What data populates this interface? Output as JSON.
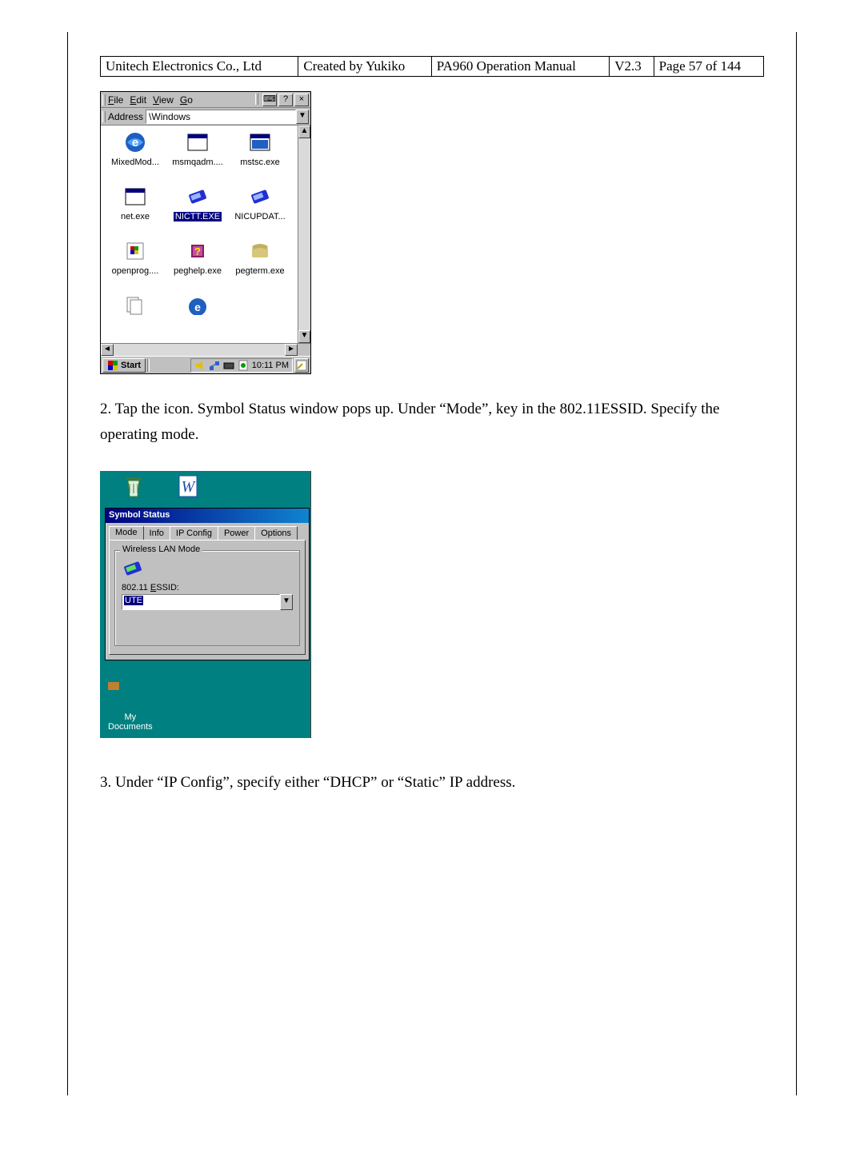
{
  "header": {
    "cells": [
      "Unitech Electronics Co., Ltd",
      "Created by Yukiko",
      "PA960 Operation Manual",
      "V2.3",
      "Page 57 of 144"
    ]
  },
  "screenshot1": {
    "menu": {
      "file": "File",
      "edit": "Edit",
      "view": "View",
      "go": "Go"
    },
    "toolbar": {
      "keyboard_icon": "⌨",
      "help_icon": "?",
      "close_icon": "×"
    },
    "address_label": "Address",
    "address_value": "\\Windows",
    "scroll": {
      "up": "▲",
      "down": "▼",
      "left": "◄",
      "right": "►"
    },
    "files": [
      {
        "name": "MixedMod...",
        "selected": false,
        "icon": "ie"
      },
      {
        "name": "msmqadm....",
        "selected": false,
        "icon": "win"
      },
      {
        "name": "mstsc.exe",
        "selected": false,
        "icon": "winblk"
      },
      {
        "name": "net.exe",
        "selected": false,
        "icon": "win"
      },
      {
        "name": "NICTT.EXE",
        "selected": true,
        "icon": "nic"
      },
      {
        "name": "NICUPDAT...",
        "selected": false,
        "icon": "nic"
      },
      {
        "name": "openprog....",
        "selected": false,
        "icon": "flag"
      },
      {
        "name": "peghelp.exe",
        "selected": false,
        "icon": "book"
      },
      {
        "name": "pegterm.exe",
        "selected": false,
        "icon": "phone"
      },
      {
        "name": "",
        "selected": false,
        "icon": "docs"
      },
      {
        "name": "",
        "selected": false,
        "icon": "ie"
      },
      {
        "name": "",
        "selected": false,
        "icon": ""
      }
    ],
    "taskbar": {
      "start_label": "Start",
      "time": "10:11 PM"
    }
  },
  "paragraph1": "2. Tap the icon. Symbol Status window pops up. Under “Mode”, key in the 802.11ESSID. Specify the operating mode.",
  "screenshot2": {
    "desktop_icons": {
      "recycle": "",
      "word": ""
    },
    "window": {
      "title": "Symbol Status",
      "tabs": [
        "Mode",
        "Info",
        "IP Config",
        "Power",
        "Options"
      ],
      "active_tab": 0,
      "group_legend": "Wireless LAN Mode",
      "essid_label": "802.11 ESSID:",
      "essid_value": "UTE",
      "dropdown_icon": "▼"
    },
    "my_docs_line1": "My",
    "my_docs_line2": "Documents"
  },
  "paragraph2": "3. Under “IP Config”, specify either “DHCP” or “Static” IP address."
}
